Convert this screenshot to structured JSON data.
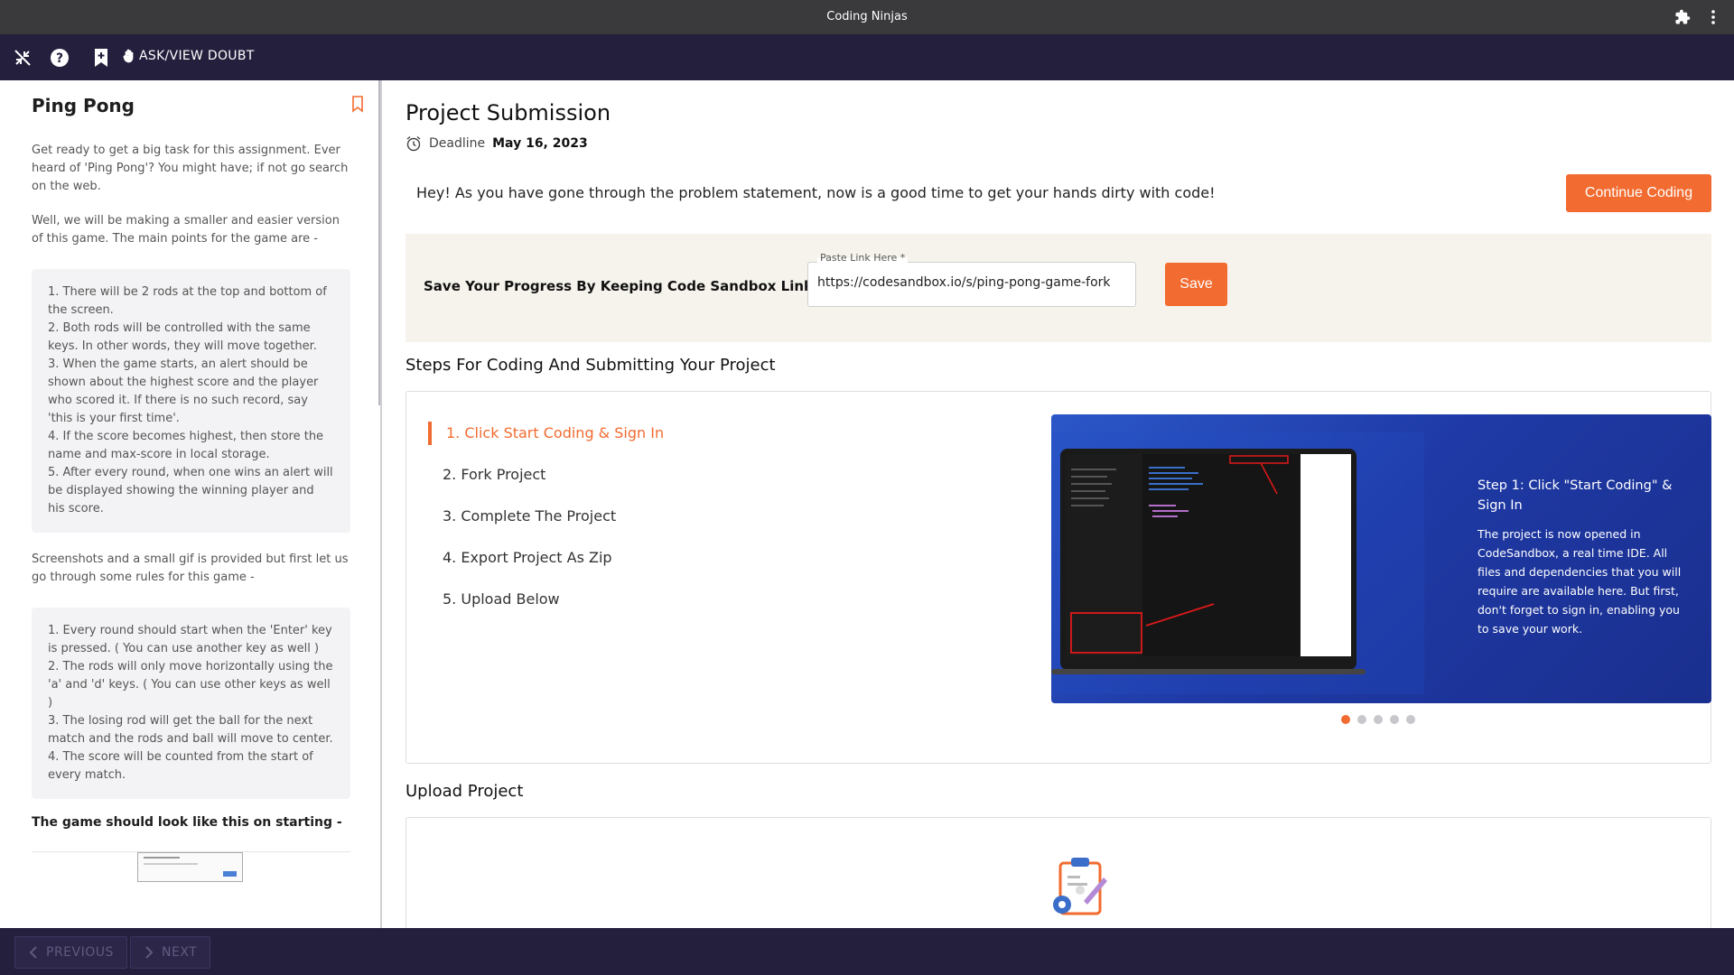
{
  "browser": {
    "title": "Coding Ninjas"
  },
  "toolbar": {
    "doubt_label": "ASK/VIEW DOUBT"
  },
  "left": {
    "title": "Ping Pong",
    "intro1": "Get ready to get a big task for this assignment. Ever heard of 'Ping Pong'? You might have; if not go search on the web.",
    "intro2": "Well, we will be making a smaller and easier version of this game. The main points for the game are -",
    "points": [
      "1. There will be 2 rods at the top and bottom of the screen.",
      "2. Both rods will be controlled with the same keys. In other words, they will move together.",
      "3. When the game starts, an alert should be shown about the highest score and the player who scored it. If there is no such record, say 'this is your first time'.",
      "4. If the score becomes highest, then store the name and max-score in local storage.",
      "5. After every round, when one wins an alert will be displayed showing the winning player and his score."
    ],
    "intro3": "Screenshots and a small gif is provided but first let us go through some rules for this game -",
    "rules": [
      "1. Every round should start when the 'Enter' key is pressed. ( You can use another key as well )",
      "2. The rods will only move horizontally using the 'a' and 'd' keys. ( You can use other keys as well )",
      "3. The losing rod will get the ball for the next match and the rods and ball will move to center.",
      "4. The score will be counted from the start of every match."
    ],
    "subheading": "The game should look like this on starting -"
  },
  "main": {
    "title": "Project Submission",
    "deadline_label": "Deadline",
    "deadline_date": "May 16, 2023",
    "intro": "Hey! As you have gone through the problem statement, now is a good time to get your hands dirty with code!",
    "continue_label": "Continue Coding",
    "save_prompt": "Save Your Progress By Keeping Code Sandbox Link Here",
    "link_legend": "Paste Link Here *",
    "link_value": "https://codesandbox.io/s/ping-pong-game-fork",
    "save_label": "Save",
    "steps_title": "Steps For Coding And Submitting Your Project",
    "steps": [
      "1. Click Start Coding & Sign In",
      "2. Fork Project",
      "3. Complete The Project",
      "4. Export Project As Zip",
      "5. Upload Below"
    ],
    "active_step": 0,
    "slide": {
      "title": "Step 1: Click \"Start Coding\" & Sign In",
      "body": "The project is now opened in CodeSandbox, a real time IDE. All files and dependencies that you will require are available here. But first, don't forget to sign in, enabling you to save your work."
    },
    "slide_count": 5,
    "upload_title": "Upload Project"
  },
  "bottom": {
    "previous_label": "PREVIOUS",
    "next_label": "NEXT"
  },
  "colors": {
    "accent": "#f26b30",
    "nav_bg": "#241f3d",
    "slide_bg": "#1f3aa6"
  }
}
